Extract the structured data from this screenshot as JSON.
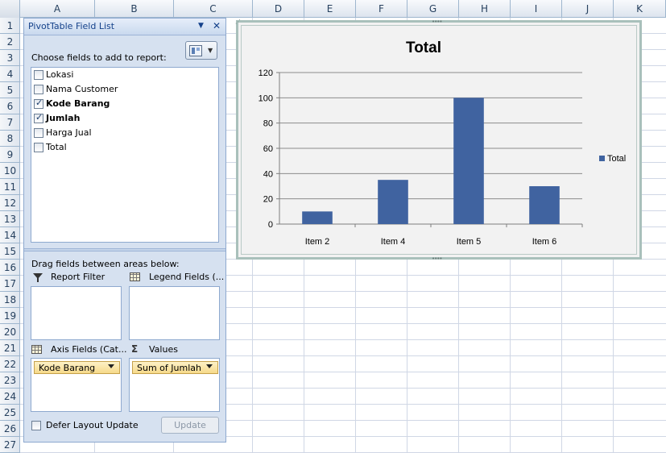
{
  "spreadsheet": {
    "columns": [
      "A",
      "B",
      "C",
      "D",
      "E",
      "F",
      "G",
      "H",
      "I",
      "J",
      "K"
    ],
    "rows": [
      "1",
      "2",
      "3",
      "4",
      "5",
      "6",
      "7",
      "8",
      "9",
      "10",
      "11",
      "12",
      "13",
      "14",
      "15",
      "16",
      "17",
      "18",
      "19",
      "20",
      "21",
      "22",
      "23",
      "24",
      "25",
      "26",
      "27"
    ]
  },
  "pivot": {
    "title": "PivotTable Field List",
    "choose_label": "Choose fields to add to report:",
    "fields": [
      {
        "label": "Lokasi",
        "checked": false
      },
      {
        "label": "Nama Customer",
        "checked": false
      },
      {
        "label": "Kode Barang",
        "checked": true
      },
      {
        "label": "Jumlah",
        "checked": true
      },
      {
        "label": "Harga Jual",
        "checked": false
      },
      {
        "label": "Total",
        "checked": false
      }
    ],
    "drag_label": "Drag fields between areas below:",
    "report_filter_label": "Report Filter",
    "legend_fields_label": "Legend Fields (...",
    "axis_fields_label": "Axis Fields (Cat...",
    "values_label": "Values",
    "axis_chip": "Kode Barang",
    "values_chip": "Sum of Jumlah",
    "defer_label": "Defer Layout Update",
    "update_label": "Update",
    "icons": {
      "dropdown": "dropdown-arrow-icon",
      "close": "close-icon",
      "filter": "filter-icon",
      "legend": "table-grid-icon",
      "axis": "table-grid-icon",
      "values": "sigma-icon"
    }
  },
  "chart_data": {
    "type": "bar",
    "title": "Total",
    "categories": [
      "Item 2",
      "Item 4",
      "Item 5",
      "Item 6"
    ],
    "series": [
      {
        "name": "Total",
        "values": [
          10,
          35,
          100,
          30
        ],
        "color": "#4063a0"
      }
    ],
    "ylim": [
      0,
      120
    ],
    "yticks": [
      "0",
      "20",
      "40",
      "60",
      "80",
      "100",
      "120"
    ],
    "grid": true,
    "legend": "right"
  }
}
